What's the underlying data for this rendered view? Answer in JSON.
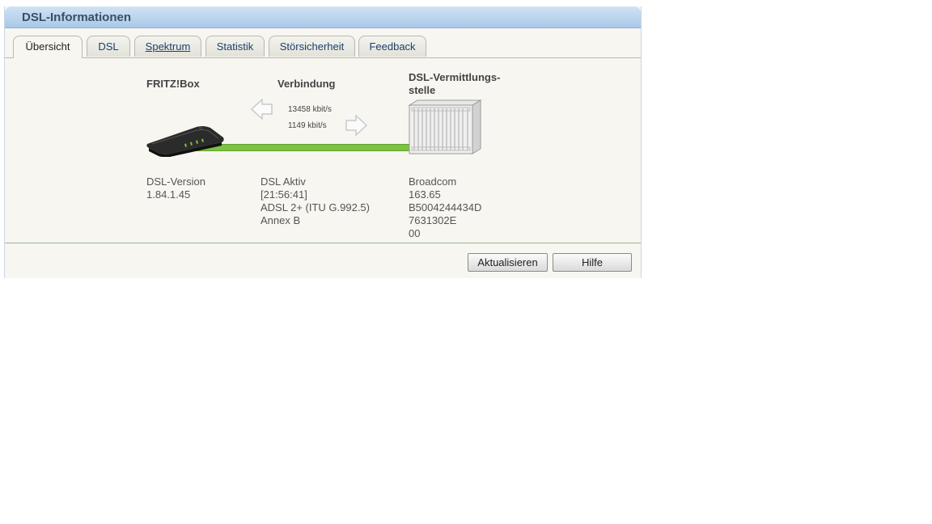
{
  "window": {
    "title": "DSL-Informationen"
  },
  "tabs": [
    {
      "label": "Übersicht",
      "active": true
    },
    {
      "label": "DSL"
    },
    {
      "label": "Spektrum"
    },
    {
      "label": "Statistik"
    },
    {
      "label": "Störsicherheit"
    },
    {
      "label": "Feedback"
    }
  ],
  "overview": {
    "device": {
      "heading": "FRITZ!Box",
      "info": [
        "DSL-Version",
        "1.84.1.45"
      ]
    },
    "connection": {
      "heading": "Verbindung",
      "downstream": "13458 kbit/s",
      "upstream": "1149 kbit/s",
      "info": [
        "DSL Aktiv",
        "[21:56:41]",
        "ADSL 2+ (ITU G.992.5)",
        "Annex B"
      ]
    },
    "exchange": {
      "heading_line1": "DSL-Vermittlungs-",
      "heading_line2": "stelle",
      "info": [
        "Broadcom",
        "163.65",
        "B5004244434D",
        "7631302E",
        "00"
      ]
    }
  },
  "buttons": {
    "refresh": "Aktualisieren",
    "help": "Hilfe"
  },
  "colors": {
    "title_bar": "#a9c9e8",
    "link_line": "#7cc243",
    "panel_bg": "#f7f6f0"
  },
  "icons": {
    "router": "router-icon",
    "exchange": "server-rack-icon",
    "down": "arrow-left-icon",
    "up": "arrow-right-icon"
  }
}
